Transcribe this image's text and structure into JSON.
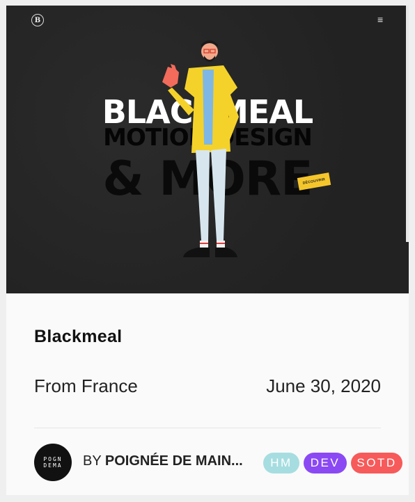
{
  "hero": {
    "logo_letter": "B",
    "menu_icon": "≡",
    "headline_1": "BLACKMEAL",
    "headline_2": "MOTION DESIGN",
    "headline_3": "& MORE",
    "discover_label": "DÉCOUVRIR"
  },
  "site": {
    "title": "Blackmeal",
    "from": "From France",
    "date": "June 30, 2020"
  },
  "author": {
    "avatar_text": "POGN\nDEMA",
    "by_prefix": "BY",
    "name": "POIGNÉE DE MAIN..."
  },
  "tags": [
    {
      "label": "HM",
      "color": "#a6dde0"
    },
    {
      "label": "DEV",
      "color": "#8b49f4"
    },
    {
      "label": "SOTD",
      "color": "#f75a5a"
    }
  ]
}
